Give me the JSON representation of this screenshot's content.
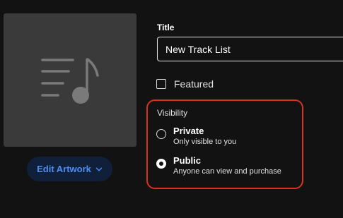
{
  "artwork": {
    "icon": "playlist-music-icon",
    "edit_label": "Edit Artwork"
  },
  "title_field": {
    "label": "Title",
    "value": "New Track List"
  },
  "featured": {
    "label": "Featured",
    "checked": false
  },
  "visibility": {
    "label": "Visibility",
    "options": [
      {
        "title": "Private",
        "description": "Only visible to you",
        "selected": false
      },
      {
        "title": "Public",
        "description": "Anyone can view and purchase",
        "selected": true
      }
    ]
  },
  "colors": {
    "background": "#121212",
    "artwork_bg": "#3a3a3a",
    "accent": "#4d8ef0",
    "highlight_border": "#d8321f"
  }
}
